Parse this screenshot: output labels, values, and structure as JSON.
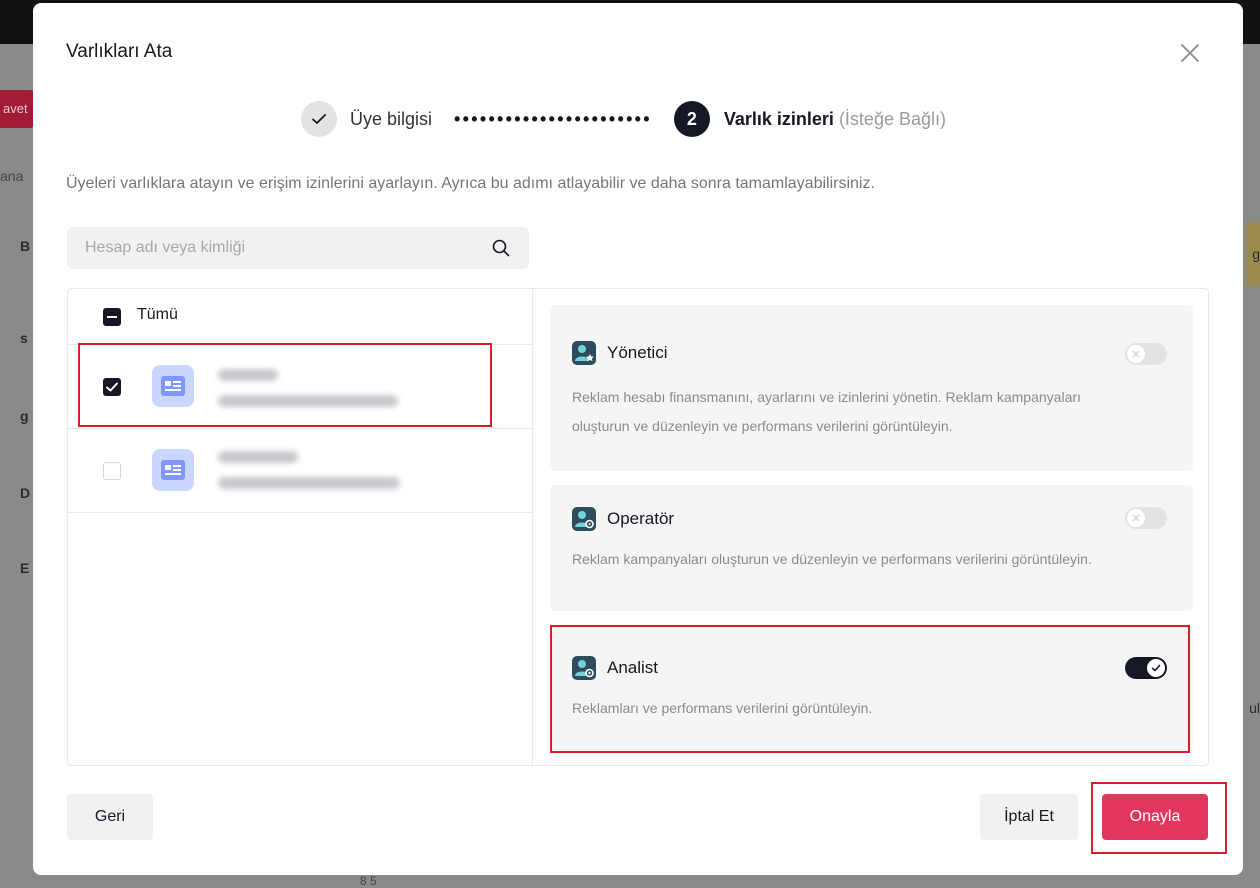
{
  "background": {
    "invite_label": "avet",
    "side_letters": [
      "ana",
      "B",
      "s",
      "g",
      "D",
      "E"
    ],
    "right_letters": [
      "g",
      "ul"
    ],
    "bottom_fragment": "8 5"
  },
  "modal": {
    "title": "Varlıkları Ata",
    "close_icon": "close-icon",
    "stepper": {
      "step1_label": "Üye bilgisi",
      "step2_number": "2",
      "step2_label": "Varlık izinleri",
      "step2_optional": "(İsteğe Bağlı)"
    },
    "description": "Üyeleri varlıklara atayın ve erişim izinlerini ayarlayın. Ayrıca bu adımı atlayabilir ve daha sonra tamamlayabilirsiniz.",
    "search": {
      "placeholder": "Hesap adı veya kimliği"
    },
    "select_all_label": "Tümü",
    "accounts": [
      {
        "checked": true,
        "name_redacted": true
      },
      {
        "checked": false,
        "name_redacted": true
      }
    ],
    "roles": [
      {
        "name": "Yönetici",
        "description": "Reklam hesabı finansmanını, ayarlarını ve izinlerini yönetin. Reklam kampanyaları oluşturun ve düzenleyin ve performans verilerini görüntüleyin.",
        "enabled": false
      },
      {
        "name": "Operatör",
        "description": "Reklam kampanyaları oluşturun ve düzenleyin ve performans verilerini görüntüleyin.",
        "enabled": false
      },
      {
        "name": "Analist",
        "description": "Reklamları ve performans verilerini görüntüleyin.",
        "enabled": true
      }
    ],
    "buttons": {
      "back": "Geri",
      "cancel": "İptal Et",
      "confirm": "Onayla"
    },
    "colors": {
      "accent": "#e1375f",
      "highlight": "#d81e2e",
      "dark": "#161823"
    }
  }
}
